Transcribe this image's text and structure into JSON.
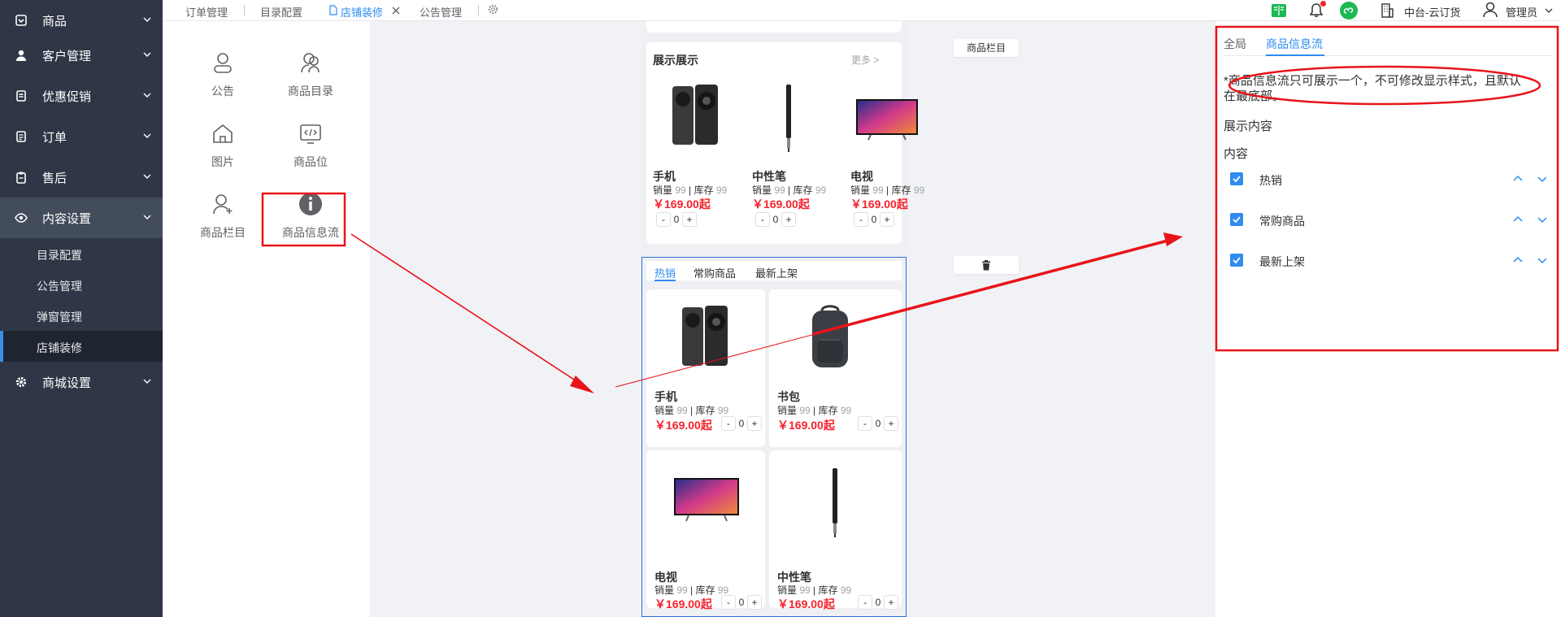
{
  "sidebar": {
    "items": [
      {
        "label": "商品"
      },
      {
        "label": "客户管理"
      },
      {
        "label": "优惠促销"
      },
      {
        "label": "订单"
      },
      {
        "label": "售后"
      },
      {
        "label": "内容设置"
      },
      {
        "label": "商城设置"
      }
    ],
    "subitems": [
      {
        "label": "目录配置"
      },
      {
        "label": "公告管理"
      },
      {
        "label": "弹窗管理"
      },
      {
        "label": "店铺装修"
      }
    ]
  },
  "tabs": [
    {
      "label": "订单管理"
    },
    {
      "label": "目录配置"
    },
    {
      "label": "店铺装修"
    },
    {
      "label": "公告管理"
    }
  ],
  "header": {
    "store": "中台-云订货",
    "user": "管理员"
  },
  "palette": {
    "components": [
      {
        "label": "公告"
      },
      {
        "label": "商品目录"
      },
      {
        "label": "图片"
      },
      {
        "label": "商品位"
      },
      {
        "label": "商品栏目"
      },
      {
        "label": "商品信息流"
      }
    ]
  },
  "canvas": {
    "showcase": {
      "title": "展示展示",
      "more": "更多 >",
      "products": [
        {
          "name": "手机",
          "sales_label": "销量",
          "sales": "99",
          "stock_label": "库存",
          "stock": "99",
          "price": "￥169.00起",
          "qty": "0"
        },
        {
          "name": "中性笔",
          "sales_label": "销量",
          "sales": "99",
          "stock_label": "库存",
          "stock": "99",
          "price": "￥169.00起",
          "qty": "0"
        },
        {
          "name": "电视",
          "sales_label": "销量",
          "sales": "99",
          "stock_label": "库存",
          "stock": "99",
          "price": "￥169.00起",
          "qty": "0"
        }
      ]
    },
    "side_tag": "商品栏目",
    "feed": {
      "tabs": [
        "热销",
        "常购商品",
        "最新上架"
      ],
      "products": [
        {
          "name": "手机",
          "sales_label": "销量",
          "sales": "99",
          "stock_label": "库存",
          "stock": "99",
          "price": "￥169.00起",
          "qty": "0"
        },
        {
          "name": "书包",
          "sales_label": "销量",
          "sales": "99",
          "stock_label": "库存",
          "stock": "99",
          "price": "￥169.00起",
          "qty": "0"
        },
        {
          "name": "电视",
          "sales_label": "销量",
          "sales": "99",
          "stock_label": "库存",
          "stock": "99",
          "price": "￥169.00起",
          "qty": "0"
        },
        {
          "name": "中性笔",
          "sales_label": "销量",
          "sales": "99",
          "stock_label": "库存",
          "stock": "99",
          "price": "￥169.00起",
          "qty": "0"
        }
      ]
    },
    "stepper": {
      "minus": "-",
      "plus": "+"
    }
  },
  "settings": {
    "tabs": [
      "全局",
      "商品信息流"
    ],
    "notice_line1": "*商品信息流只可展示一个，不可修改显示样式，且默认",
    "notice_line2": "在最底部。",
    "display_label": "展示内容",
    "content_label": "内容",
    "items": [
      {
        "label": "热销"
      },
      {
        "label": "常购商品"
      },
      {
        "label": "最新上架"
      }
    ]
  },
  "colors": {
    "sidebar_bg": "#2f3746",
    "accent": "#2d8cf0",
    "price": "#f5222d",
    "annotation": "#e8141a"
  }
}
